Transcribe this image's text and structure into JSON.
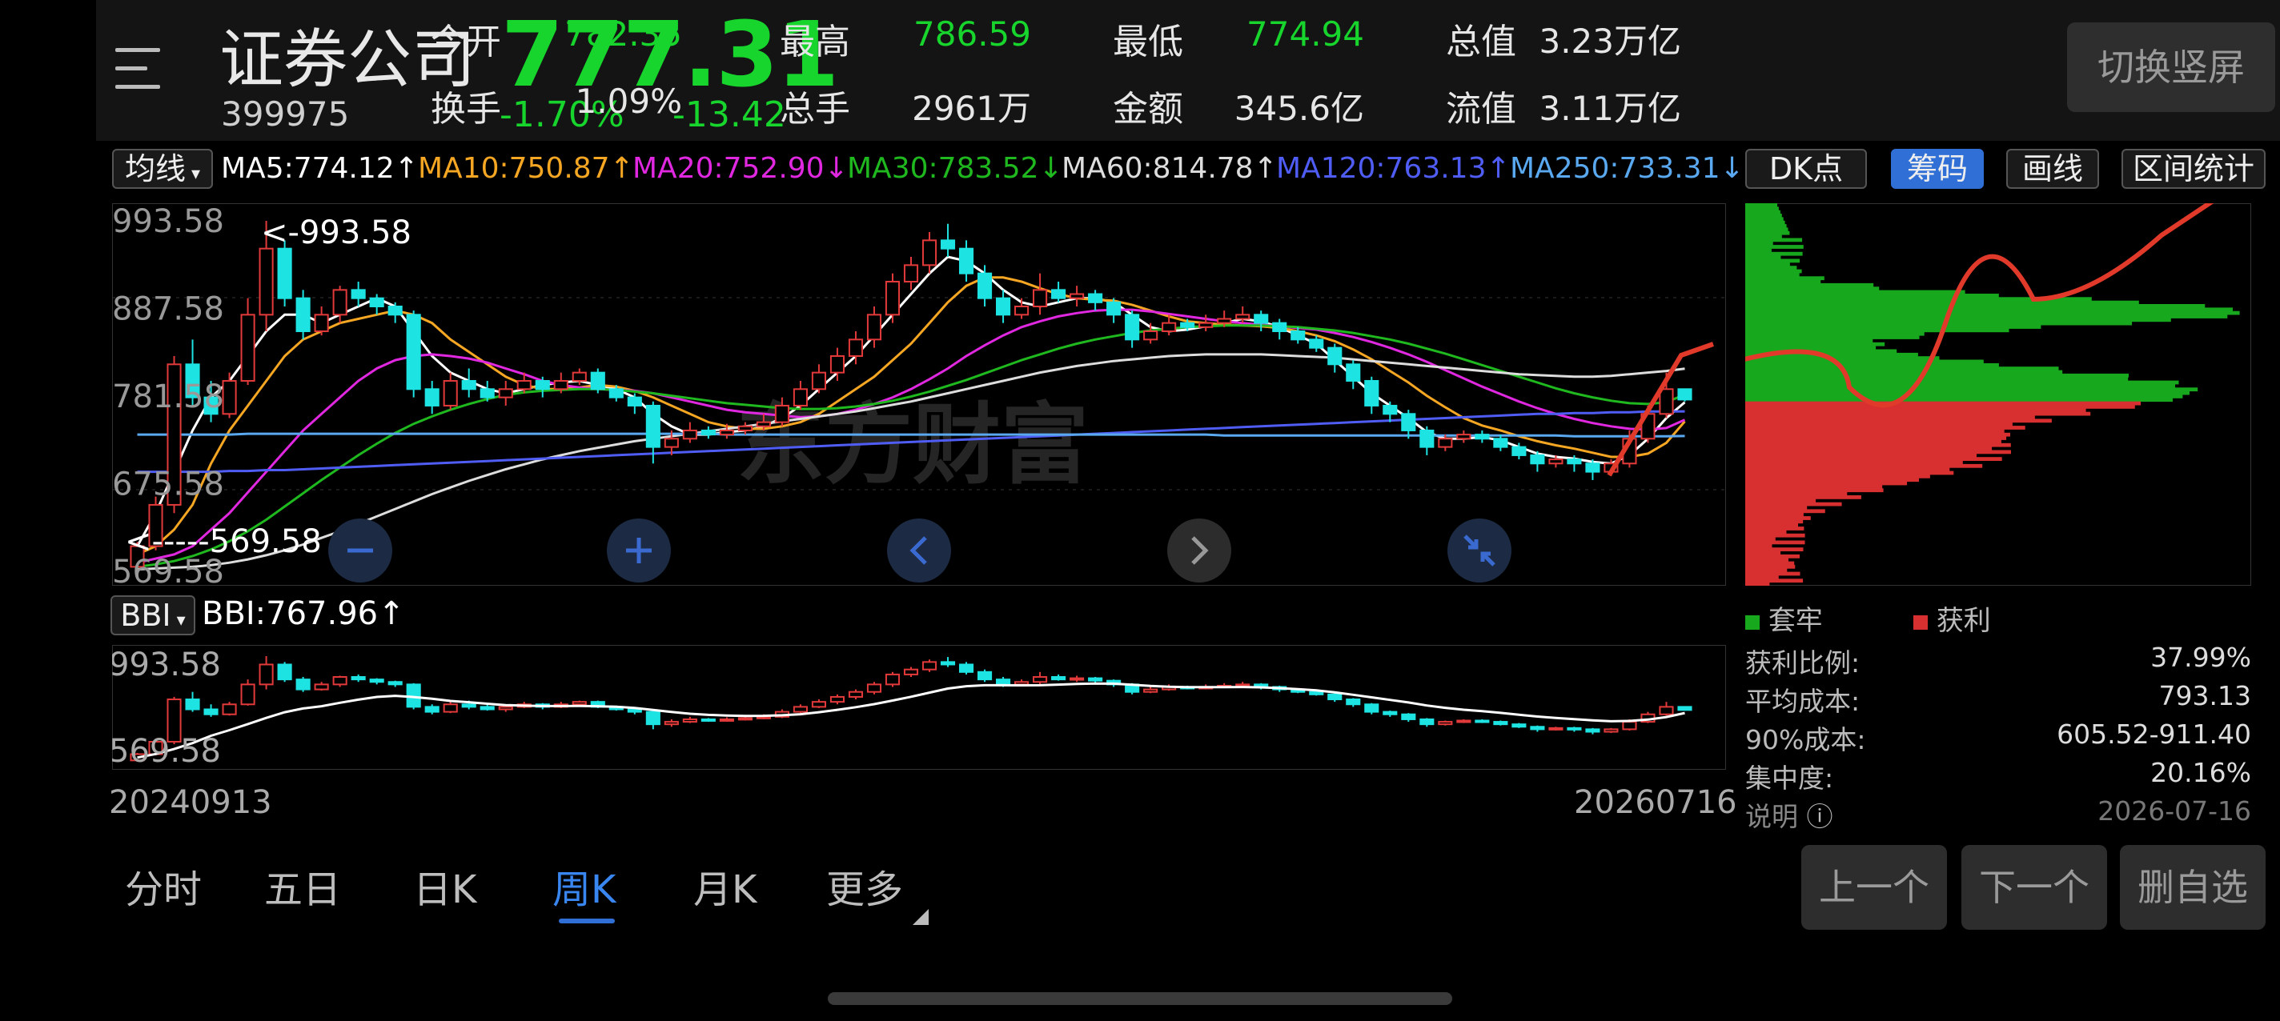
{
  "header": {
    "name": "证券公司",
    "code": "399975",
    "price": "777.31",
    "change_pct": "-1.70%",
    "change_abs": "-13.42",
    "quotes": [
      {
        "label": "今开",
        "value": "782.35",
        "color": "#17d52c"
      },
      {
        "label": "最高",
        "value": "786.59",
        "color": "#17d52c"
      },
      {
        "label": "最低",
        "value": "774.94",
        "color": "#17d52c"
      },
      {
        "label": "总值",
        "value": "3.23万亿",
        "color": "#e6e6e6"
      },
      {
        "label": "换手",
        "value": "1.09%",
        "color": "#e6e6e6"
      },
      {
        "label": "总手",
        "value": "2961万",
        "color": "#e6e6e6"
      },
      {
        "label": "金额",
        "value": "345.6亿",
        "color": "#e6e6e6"
      },
      {
        "label": "流值",
        "value": "3.11万亿",
        "color": "#e6e6e6"
      }
    ],
    "switch_label": "切换竖屏"
  },
  "indicator_bar": {
    "selector": "均线",
    "ma": [
      {
        "text": "MA5:774.12↑",
        "color": "#ffffff"
      },
      {
        "text": "MA10:750.87↑",
        "color": "#f5a623"
      },
      {
        "text": "MA20:752.90↓",
        "color": "#e028e0"
      },
      {
        "text": "MA30:783.52↓",
        "color": "#1fb81f"
      },
      {
        "text": "MA60:814.78↑",
        "color": "#dddddd"
      },
      {
        "text": "MA120:763.13↑",
        "color": "#4f5df5"
      },
      {
        "text": "MA250:733.31↓",
        "color": "#5aa9f0"
      }
    ],
    "dk_label": "DK点",
    "chip_label": "筹码",
    "draw_label": "画线",
    "range_label": "区间统计"
  },
  "main_chart": {
    "y_ticks": [
      "993.58",
      "887.58",
      "781.58",
      "675.58",
      "569.58"
    ],
    "max_marker": "<-993.58",
    "min_marker": "<-----569.58",
    "watermark": "东方财富"
  },
  "bbi": {
    "selector": "BBI",
    "value": "BBI:767.96↑",
    "y_top": "993.58",
    "y_bottom": "569.58",
    "date_start": "20240913",
    "date_end": "20260716"
  },
  "chip": {
    "legend_trapped": "套牢",
    "legend_profit": "获利",
    "rows": [
      {
        "label": "获利比例:",
        "value": "37.99%"
      },
      {
        "label": "平均成本:",
        "value": "793.13"
      },
      {
        "label": "90%成本:",
        "value": "605.52-911.40"
      },
      {
        "label": "集中度:",
        "value": "20.16%"
      },
      {
        "label": "说明",
        "value": "2026-07-16"
      }
    ]
  },
  "tabs": [
    "分时",
    "五日",
    "日K",
    "周K",
    "月K",
    "更多"
  ],
  "active_tab": "周K",
  "nav": {
    "prev": "上一个",
    "next": "下一个",
    "remove": "删自选"
  },
  "colors": {
    "up": "#e23a3a",
    "down": "#1ee3e3",
    "green": "#17d52c",
    "accent": "#2f6fd6"
  },
  "chart_data": {
    "type": "candlestick",
    "ylim": [
      569.58,
      993.58
    ],
    "candles": [
      [
        575,
        600,
        569.58,
        605
      ],
      [
        600,
        650,
        595,
        660
      ],
      [
        650,
        820,
        640,
        830
      ],
      [
        820,
        780,
        770,
        850
      ],
      [
        780,
        760,
        750,
        800
      ],
      [
        760,
        800,
        755,
        810
      ],
      [
        800,
        880,
        795,
        900
      ],
      [
        880,
        960,
        860,
        993.58
      ],
      [
        960,
        900,
        890,
        970
      ],
      [
        900,
        860,
        850,
        910
      ],
      [
        860,
        880,
        855,
        890
      ],
      [
        880,
        910,
        870,
        915
      ],
      [
        910,
        900,
        890,
        920
      ],
      [
        900,
        890,
        880,
        905
      ],
      [
        890,
        880,
        870,
        895
      ],
      [
        880,
        790,
        780,
        885
      ],
      [
        790,
        770,
        760,
        800
      ],
      [
        770,
        800,
        765,
        810
      ],
      [
        800,
        790,
        780,
        815
      ],
      [
        790,
        780,
        775,
        800
      ],
      [
        780,
        790,
        770,
        800
      ],
      [
        790,
        800,
        785,
        810
      ],
      [
        800,
        790,
        780,
        805
      ],
      [
        790,
        800,
        785,
        810
      ],
      [
        800,
        810,
        795,
        815
      ],
      [
        810,
        790,
        785,
        815
      ],
      [
        790,
        780,
        775,
        795
      ],
      [
        780,
        770,
        760,
        785
      ],
      [
        770,
        720,
        700,
        775
      ],
      [
        720,
        730,
        710,
        740
      ],
      [
        730,
        740,
        725,
        750
      ],
      [
        740,
        735,
        730,
        745
      ],
      [
        735,
        740,
        730,
        748
      ],
      [
        740,
        745,
        735,
        750
      ],
      [
        745,
        750,
        740,
        760
      ],
      [
        750,
        770,
        745,
        780
      ],
      [
        770,
        790,
        765,
        800
      ],
      [
        790,
        810,
        785,
        820
      ],
      [
        810,
        830,
        800,
        840
      ],
      [
        830,
        850,
        820,
        860
      ],
      [
        850,
        880,
        840,
        890
      ],
      [
        880,
        920,
        870,
        930
      ],
      [
        920,
        940,
        910,
        950
      ],
      [
        940,
        970,
        930,
        980
      ],
      [
        970,
        960,
        950,
        990
      ],
      [
        960,
        930,
        920,
        970
      ],
      [
        930,
        900,
        890,
        940
      ],
      [
        900,
        880,
        870,
        910
      ],
      [
        880,
        890,
        875,
        900
      ],
      [
        890,
        910,
        880,
        930
      ],
      [
        910,
        900,
        895,
        920
      ],
      [
        900,
        905,
        890,
        915
      ],
      [
        905,
        895,
        885,
        910
      ],
      [
        895,
        880,
        870,
        900
      ],
      [
        880,
        850,
        840,
        885
      ],
      [
        850,
        860,
        845,
        870
      ],
      [
        860,
        870,
        855,
        880
      ],
      [
        870,
        865,
        860,
        875
      ],
      [
        865,
        870,
        860,
        880
      ],
      [
        870,
        875,
        865,
        885
      ],
      [
        875,
        880,
        870,
        890
      ],
      [
        880,
        870,
        860,
        885
      ],
      [
        870,
        860,
        850,
        875
      ],
      [
        860,
        850,
        845,
        865
      ],
      [
        850,
        840,
        835,
        855
      ],
      [
        840,
        820,
        810,
        845
      ],
      [
        820,
        800,
        790,
        825
      ],
      [
        800,
        770,
        760,
        805
      ],
      [
        770,
        760,
        750,
        775
      ],
      [
        760,
        740,
        730,
        765
      ],
      [
        740,
        720,
        710,
        745
      ],
      [
        720,
        730,
        715,
        735
      ],
      [
        730,
        735,
        725,
        740
      ],
      [
        735,
        730,
        725,
        740
      ],
      [
        730,
        720,
        715,
        735
      ],
      [
        720,
        710,
        705,
        725
      ],
      [
        710,
        700,
        690,
        715
      ],
      [
        700,
        705,
        695,
        710
      ],
      [
        705,
        700,
        690,
        710
      ],
      [
        700,
        690,
        680,
        705
      ],
      [
        690,
        700,
        685,
        705
      ],
      [
        700,
        730,
        695,
        740
      ],
      [
        730,
        760,
        725,
        770
      ],
      [
        760,
        790,
        755,
        810
      ],
      [
        790,
        777.31,
        774.94,
        786.59
      ]
    ],
    "ma": {
      "MA5": [
        600,
        640,
        690,
        740,
        780,
        800,
        830,
        860,
        880,
        880,
        870,
        880,
        890,
        900,
        890,
        860,
        830,
        810,
        800,
        790,
        785,
        790,
        795,
        798,
        800,
        795,
        790,
        780,
        760,
        745,
        735,
        735,
        738,
        740,
        745,
        755,
        770,
        790,
        810,
        830,
        855,
        880,
        905,
        930,
        950,
        945,
        930,
        910,
        895,
        890,
        895,
        900,
        900,
        895,
        880,
        865,
        860,
        862,
        866,
        870,
        875,
        872,
        865,
        855,
        845,
        825,
        805,
        785,
        770,
        755,
        738,
        730,
        730,
        732,
        728,
        720,
        712,
        708,
        706,
        702,
        700,
        710,
        730,
        755,
        774.12
      ],
      "MA10": [
        590,
        600,
        620,
        650,
        700,
        740,
        770,
        800,
        830,
        850,
        860,
        870,
        875,
        880,
        885,
        880,
        870,
        850,
        835,
        820,
        805,
        795,
        790,
        790,
        792,
        795,
        793,
        788,
        780,
        770,
        760,
        750,
        745,
        742,
        742,
        745,
        750,
        760,
        775,
        790,
        805,
        825,
        845,
        870,
        895,
        915,
        925,
        925,
        920,
        912,
        905,
        900,
        898,
        897,
        892,
        885,
        878,
        872,
        870,
        868,
        867,
        866,
        864,
        860,
        855,
        848,
        838,
        826,
        812,
        798,
        782,
        768,
        755,
        746,
        740,
        733,
        727,
        722,
        718,
        713,
        708,
        708,
        712,
        725,
        750.87
      ],
      "MA20": [
        580,
        585,
        590,
        600,
        620,
        640,
        665,
        690,
        715,
        740,
        760,
        780,
        800,
        815,
        825,
        830,
        832,
        830,
        827,
        822,
        815,
        808,
        800,
        795,
        792,
        790,
        789,
        788,
        785,
        780,
        775,
        770,
        765,
        762,
        760,
        758,
        756,
        757,
        760,
        765,
        772,
        780,
        790,
        802,
        815,
        830,
        843,
        855,
        865,
        872,
        878,
        882,
        885,
        886,
        886,
        884,
        881,
        878,
        875,
        872,
        870,
        868,
        866,
        864,
        862,
        858,
        853,
        847,
        840,
        832,
        823,
        813,
        803,
        793,
        784,
        775,
        767,
        760,
        754,
        749,
        745,
        742,
        741,
        743,
        752.9
      ],
      "MA30": [
        575,
        578,
        582,
        588,
        596,
        606,
        618,
        632,
        648,
        664,
        680,
        695,
        710,
        724,
        737,
        748,
        757,
        765,
        772,
        778,
        783,
        786,
        788,
        789,
        790,
        790,
        789,
        787,
        785,
        782,
        779,
        776,
        773,
        771,
        769,
        767,
        766,
        766,
        767,
        769,
        772,
        776,
        781,
        787,
        794,
        801,
        809,
        817,
        825,
        832,
        839,
        845,
        850,
        854,
        858,
        861,
        863,
        865,
        866,
        867,
        867,
        867,
        866,
        865,
        863,
        861,
        858,
        854,
        850,
        845,
        839,
        833,
        826,
        819,
        812,
        805,
        798,
        791,
        785,
        780,
        776,
        773,
        772,
        774,
        783.52
      ],
      "MA60": [
        572,
        573,
        574,
        575,
        577,
        580,
        584,
        589,
        595,
        602,
        610,
        618,
        627,
        636,
        645,
        654,
        663,
        671,
        679,
        686,
        693,
        699,
        705,
        710,
        715,
        719,
        723,
        727,
        730,
        733,
        736,
        739,
        742,
        745,
        748,
        751,
        754,
        757,
        760,
        763,
        767,
        771,
        775,
        780,
        785,
        790,
        795,
        800,
        805,
        810,
        814,
        818,
        821,
        824,
        826,
        828,
        830,
        831,
        832,
        832,
        832,
        832,
        831,
        830,
        829,
        828,
        826,
        824,
        822,
        820,
        818,
        816,
        814,
        812,
        810,
        808,
        807,
        806,
        805,
        805,
        806,
        808,
        810,
        812,
        814.78
      ],
      "MA120": [
        690,
        690,
        690,
        690,
        690,
        691,
        691,
        692,
        692,
        693,
        694,
        695,
        696,
        697,
        698,
        699,
        700,
        701,
        702,
        703,
        704,
        705,
        706,
        707,
        708,
        709,
        710,
        711,
        712,
        713,
        714,
        715,
        716,
        717,
        718,
        719,
        720,
        721,
        722,
        723,
        724,
        725,
        726,
        727,
        728,
        729,
        730,
        731,
        732,
        733,
        734,
        735,
        736,
        737,
        738,
        739,
        740,
        741,
        742,
        743,
        744,
        745,
        746,
        747,
        748,
        749,
        750,
        751,
        752,
        753,
        754,
        755,
        756,
        757,
        758,
        759,
        760,
        760,
        761,
        761,
        762,
        762,
        763,
        763,
        763.13
      ],
      "MA250": [
        735,
        735,
        735,
        735,
        735,
        735,
        736,
        736,
        736,
        736,
        736,
        736,
        736,
        736,
        736,
        736,
        736,
        736,
        736,
        736,
        736,
        736,
        736,
        736,
        736,
        736,
        736,
        736,
        736,
        736,
        736,
        736,
        735,
        735,
        735,
        735,
        735,
        735,
        735,
        735,
        735,
        735,
        735,
        735,
        735,
        735,
        735,
        735,
        735,
        735,
        735,
        735,
        735,
        735,
        735,
        735,
        735,
        735,
        735,
        734,
        734,
        734,
        734,
        734,
        734,
        734,
        734,
        734,
        734,
        734,
        734,
        734,
        734,
        734,
        734,
        734,
        734,
        734,
        733,
        733,
        733,
        733,
        733,
        733,
        733.31
      ]
    }
  }
}
